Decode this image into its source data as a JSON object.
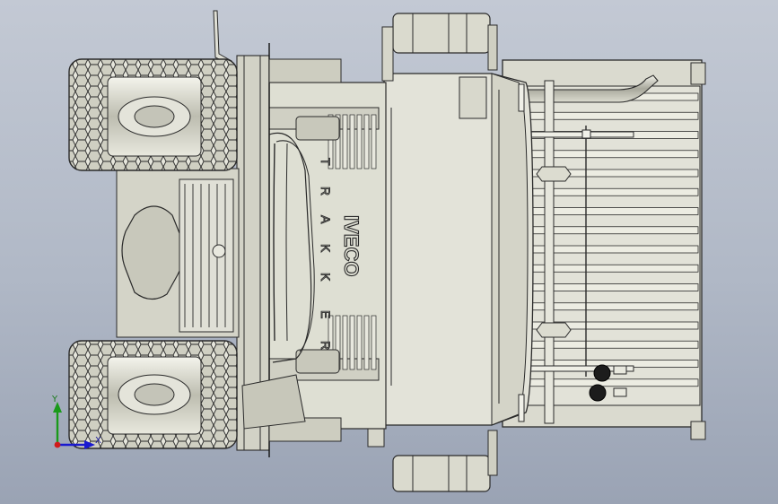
{
  "viewport": {
    "background_top": "#c3c9d4",
    "background_bottom": "#9aa3b4",
    "model_fill": "#d9d9cc",
    "model_stroke": "#2a2a2a"
  },
  "model": {
    "brand_logo": "IVECO",
    "grille_lettering": [
      "T",
      "R",
      "A",
      "K",
      "K",
      "E",
      "R"
    ],
    "tire_tread_pattern": "hexagonal-block",
    "cargo_bed_slats": 16
  },
  "triad": {
    "y_label": "Y",
    "x_label": "X",
    "y_color": "#1a9a1a",
    "x_color": "#1a1ad0",
    "origin_color": "#d01a1a"
  }
}
